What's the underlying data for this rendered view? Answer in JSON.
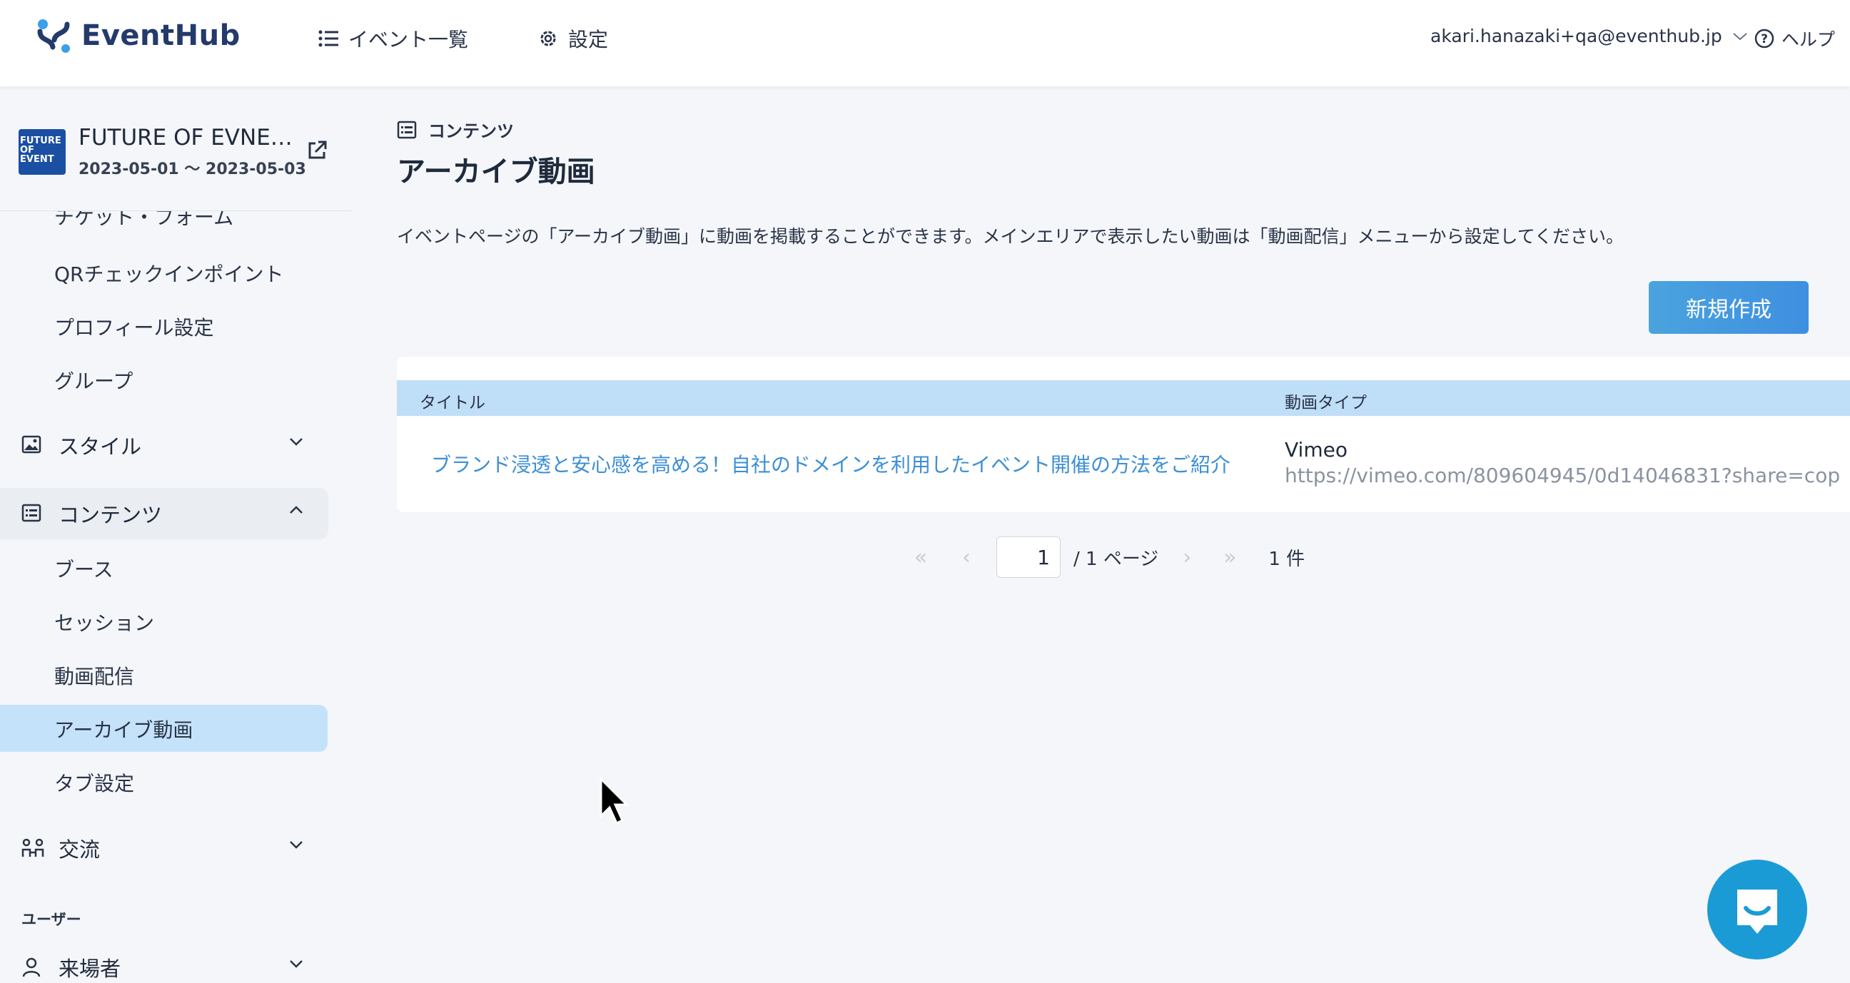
{
  "header": {
    "logo_text": "EventHub",
    "nav": {
      "events_label": "イベント一覧",
      "settings_label": "設定"
    },
    "user_email": "akari.hanazaki+qa@eventhub.jp",
    "help_label": "ヘルプ"
  },
  "event": {
    "name": "FUTURE OF EVNE…",
    "dates": "2023-05-01 〜 2023-05-03",
    "thumb_text": "FUTURE OF EVENT"
  },
  "sidebar": {
    "cut_item": "チケット・フォーム",
    "ticket_subitems": [
      "QRチェックインポイント",
      "プロフィール設定",
      "グループ"
    ],
    "style_label": "スタイル",
    "content_label": "コンテンツ",
    "content_subitems": [
      "ブース",
      "セッション",
      "動画配信",
      "アーカイブ動画",
      "タブ設定"
    ],
    "active_item": "アーカイブ動画",
    "exchange_label": "交流",
    "user_section": "ユーザー",
    "visitors_label": "来場者"
  },
  "main": {
    "breadcrumb": "コンテンツ",
    "title": "アーカイブ動画",
    "description": "イベントページの「アーカイブ動画」に動画を掲載することができます。メインエリアで表示したい動画は「動画配信」メニューから設定してください。",
    "new_button": "新規作成",
    "table": {
      "headers": [
        "タイトル",
        "動画タイプ"
      ],
      "rows": [
        {
          "title": "ブランド浸透と安心感を高める！自社のドメインを利用したイベント開催の方法をご紹介",
          "type": "Vimeo",
          "url": "https://vimeo.com/809604945/0d14046831?share=cop"
        }
      ]
    },
    "pagination": {
      "page": "1",
      "total": "/ 1 ページ",
      "count": "1 件"
    }
  },
  "colors": {
    "accent": "#3d8fd4",
    "active_bg": "#c5e2fb",
    "table_head": "#bfdef7",
    "button": "#4aa3dd",
    "chat": "#1b9bd6"
  },
  "icons": [
    "eventhub-logo-icon",
    "list-icon",
    "gear-icon",
    "chevron-down-icon",
    "help-icon",
    "external-link-icon",
    "image-icon",
    "list-icon",
    "chevron-up-icon",
    "people-icon",
    "user-icon",
    "chat-icon",
    "cursor-icon"
  ]
}
